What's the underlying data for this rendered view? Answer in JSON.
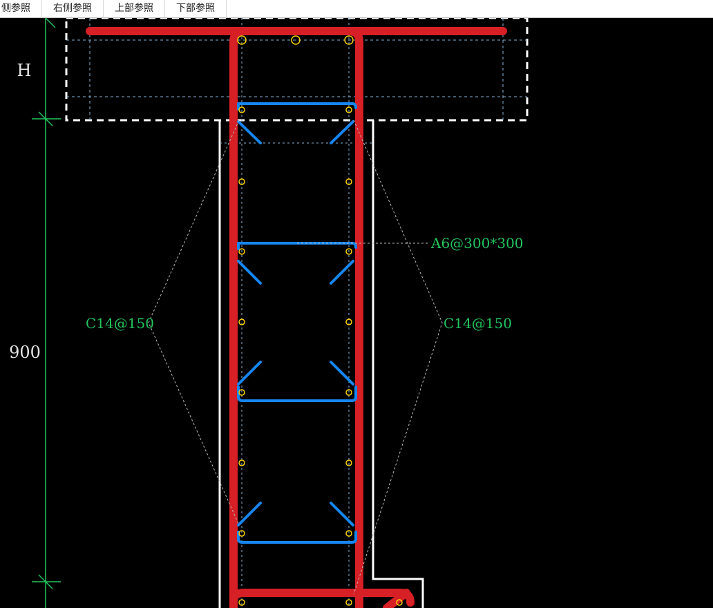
{
  "toolbar": {
    "tabs": [
      {
        "label": "侧参照"
      },
      {
        "label": "右侧参照"
      },
      {
        "label": "上部参照"
      },
      {
        "label": "下部参照"
      }
    ]
  },
  "drawing": {
    "dimensions": {
      "height_label": "H",
      "length_label": "900"
    },
    "labels": {
      "tie_spec": "A6@300*300",
      "left_bar": "C14@150",
      "right_bar": "C14@150"
    },
    "colors": {
      "background": "#000000",
      "dimension": "#22c55e",
      "outline": "#ffffff",
      "main_rebar": "#d71f26",
      "stirrup": "#1686f2",
      "node": "#ffd400",
      "leader": "#bdbdbd",
      "text": "#e5e5e5"
    }
  }
}
